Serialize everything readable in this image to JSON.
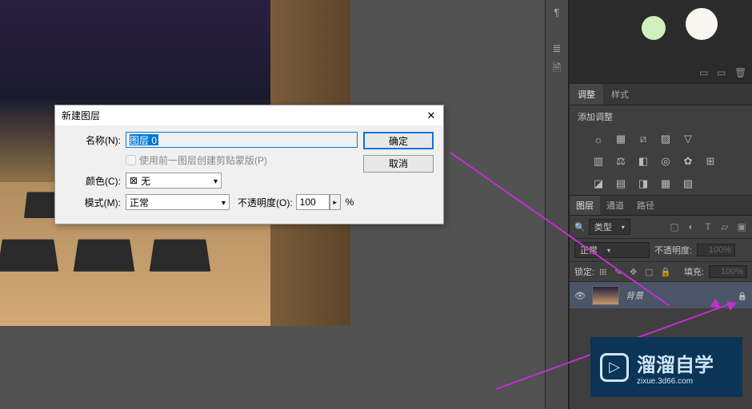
{
  "dialog": {
    "title": "新建图层",
    "name_label": "名称(N):",
    "name_value": "图层 0",
    "clip_label": "使用前一图层创建剪贴蒙版(P)",
    "color_label": "颜色(C):",
    "color_value": "无",
    "mode_label": "模式(M):",
    "mode_value": "正常",
    "opacity_label": "不透明度(O):",
    "opacity_value": "100",
    "percent": "%",
    "ok": "确定",
    "cancel": "取消"
  },
  "adjust": {
    "tab1": "调整",
    "tab2": "样式",
    "header": "添加调整"
  },
  "layers": {
    "tab1": "图层",
    "tab2": "通道",
    "tab3": "路径",
    "type_filter": "类型",
    "blend": "正常",
    "opacity_label": "不透明度:",
    "opacity_val": "100%",
    "lock_label": "锁定:",
    "fill_label": "填充:",
    "fill_val": "100%",
    "bg_layer": "背景"
  },
  "watermark": {
    "brand": "溜溜自学",
    "url": "zixue.3d66.com"
  }
}
